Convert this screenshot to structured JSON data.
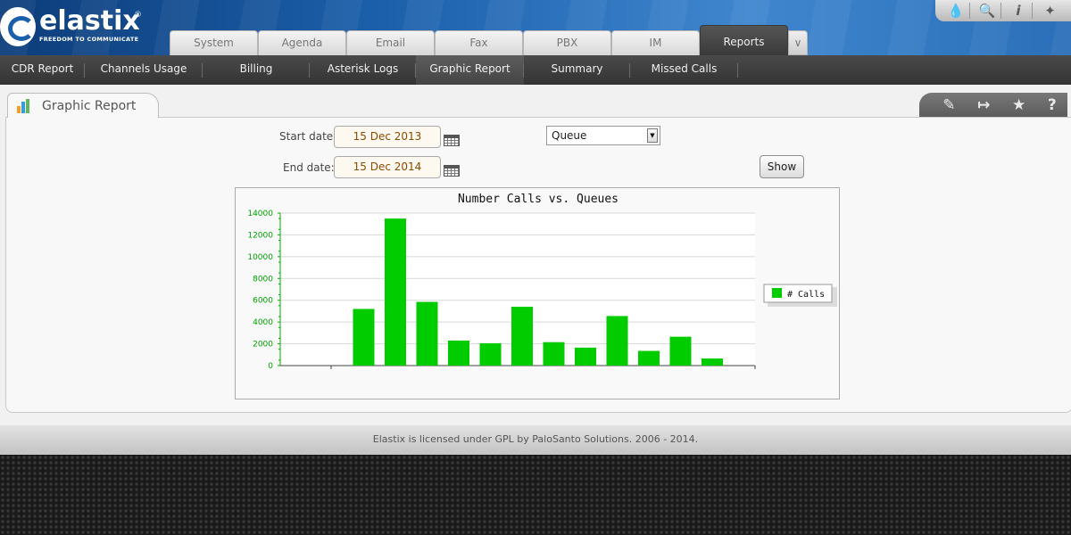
{
  "brand": {
    "name": "elastix",
    "registered": "®",
    "tagline": "FREEDOM TO COMMUNICATE"
  },
  "top_tools": [
    {
      "icon": "drop-icon",
      "glyph": "❗"
    },
    {
      "icon": "search-icon",
      "glyph": "⌕"
    },
    {
      "icon": "info-icon",
      "glyph": "i"
    },
    {
      "icon": "puzzle-icon",
      "glyph": "✚"
    }
  ],
  "main_tabs": [
    {
      "label": "System"
    },
    {
      "label": "Agenda"
    },
    {
      "label": "Email"
    },
    {
      "label": "Fax"
    },
    {
      "label": "PBX"
    },
    {
      "label": "IM"
    },
    {
      "label": "Reports",
      "active": true
    }
  ],
  "sub_nav": [
    {
      "label": "CDR Report"
    },
    {
      "label": "Channels Usage"
    },
    {
      "label": "Billing"
    },
    {
      "label": "Asterisk Logs"
    },
    {
      "label": "Graphic Report",
      "active": true
    },
    {
      "label": "Summary"
    },
    {
      "label": "Missed Calls"
    }
  ],
  "module": {
    "title": "Graphic Report",
    "actions": [
      {
        "icon": "edit-icon",
        "glyph": "✎"
      },
      {
        "icon": "export-icon",
        "glyph": "↦"
      },
      {
        "icon": "star-icon",
        "glyph": "★"
      },
      {
        "icon": "help-icon",
        "glyph": "?"
      }
    ]
  },
  "form": {
    "start_date_label": "Start date:",
    "start_date_value": "15 Dec 2013",
    "end_date_label": "End date:",
    "end_date_value": "15 Dec 2014",
    "queue_value": "Queue",
    "show_label": "Show"
  },
  "chart_data": {
    "type": "bar",
    "title": "Number Calls vs. Queues",
    "xlabel": "",
    "ylabel": "",
    "ylim": [
      0,
      14000
    ],
    "yticks": [
      0,
      2000,
      4000,
      6000,
      8000,
      10000,
      12000,
      14000
    ],
    "grid": true,
    "legend": "right",
    "series": [
      {
        "name": "# Calls",
        "color": "#00cc00",
        "values": [
          5200,
          13500,
          5850,
          2300,
          2050,
          5400,
          2150,
          1650,
          4550,
          1350,
          2650,
          650
        ]
      }
    ]
  },
  "footer": {
    "text": "Elastix is licensed under GPL by PaloSanto Solutions. 2006 - 2014."
  }
}
